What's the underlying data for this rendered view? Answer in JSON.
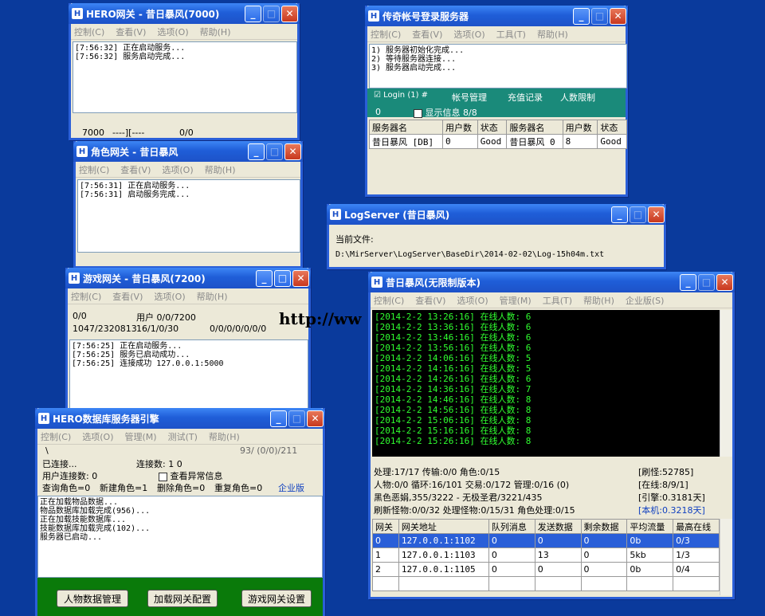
{
  "hero_gate": {
    "title": "HERO网关 - 昔日暴风(7000)",
    "menu": [
      "控制(C)",
      "查看(V)",
      "选项(O)",
      "帮助(H)"
    ],
    "log": [
      "[7:56:32] 正在启动服务...",
      "[7:56:32] 服务启动完成..."
    ],
    "status": [
      "7000",
      "----][----",
      "0/0"
    ]
  },
  "login_srv": {
    "title": "传奇帐号登录服务器",
    "menu": [
      "控制(C)",
      "查看(V)",
      "选项(O)",
      "工具(T)",
      "帮助(H)"
    ],
    "log": [
      "1) 服务器初始化完成...",
      "2) 等待服务器连接...",
      "3) 服务器启动完成..."
    ],
    "login_tab": "Login (1) #",
    "tabs": [
      "帐号管理",
      "充值记录",
      "人数限制"
    ],
    "count": "0",
    "show_info": "显示信息",
    "ratio": "8/8",
    "headers": [
      "服务器名",
      "用户数",
      "状态",
      "服务器名",
      "用户数",
      "状态"
    ],
    "row": [
      "昔日暴风 [DB]",
      "0",
      "Good",
      "昔日暴风 0",
      "8",
      "Good"
    ]
  },
  "role_gate": {
    "title": "角色网关 - 昔日暴风",
    "menu": [
      "控制(C)",
      "查看(V)",
      "选项(O)",
      "帮助(H)"
    ],
    "log": [
      "[7:56:31] 正在启动服务...",
      "[7:56:31] 启动服务完成..."
    ]
  },
  "log_server": {
    "title": "LogServer (昔日暴风)",
    "label": "当前文件:",
    "path": "D:\\MirServer\\LogServer\\BaseDir\\2014-02-02\\Log-15h04m.txt"
  },
  "game_gate": {
    "title": "游戏网关 - 昔日暴风(7200)",
    "menu": [
      "控制(C)",
      "查看(V)",
      "选项(O)",
      "帮助(H)"
    ],
    "l1": "0/0",
    "l2": "用户 0/0/7200",
    "l3": "1047/2320813",
    "l4": "16/1/0/30",
    "l5": "0/0/0/0/0/0/0",
    "log": [
      "[7:56:25] 正在启动服务...",
      "[7:56:25] 服务已启动成功...",
      "[7:56:25] 连接成功 127.0.0.1:5000"
    ]
  },
  "db_srv": {
    "title": "HERO数据库服务器引擎",
    "menu": [
      "控制(C)",
      "选项(O)",
      "管理(M)",
      "测试(T)",
      "帮助(H)"
    ],
    "slash": "\\",
    "topright": "93/ (0/0)/211",
    "connected": "已连接...",
    "conn_count": "连接数: 1    0",
    "user_conn": "用户连接数:    0",
    "check_label": "查看异常信息",
    "query": "查询角色=0",
    "new_role": "新建角色=1",
    "del_role": "删除角色=0",
    "dup_role": "重复角色=0",
    "edition": "企业版",
    "log": [
      "正在加载物品数据...",
      "物品数据库加载完成(956)...",
      "正在加载技能数据库...",
      "技能数据库加载完成(102)...",
      "服务器已启动..."
    ],
    "buttons": [
      "人物数据管理",
      "加载网关配置",
      "游戏网关设置"
    ]
  },
  "watermark": "http://ww",
  "main": {
    "title": "昔日暴风(无限制版本)",
    "menu": [
      "控制(C)",
      "查看(V)",
      "选项(O)",
      "管理(M)",
      "工具(T)",
      "帮助(H)",
      "企业版(S)"
    ],
    "log": [
      "[2014-2-2 13:26:16] 在线人数: 6",
      "[2014-2-2 13:36:16] 在线人数: 6",
      "[2014-2-2 13:46:16] 在线人数: 6",
      "[2014-2-2 13:56:16] 在线人数: 6",
      "[2014-2-2 14:06:16] 在线人数: 5",
      "[2014-2-2 14:16:16] 在线人数: 5",
      "[2014-2-2 14:26:16] 在线人数: 6",
      "[2014-2-2 14:36:16] 在线人数: 7",
      "[2014-2-2 14:46:16] 在线人数: 8",
      "[2014-2-2 14:56:16] 在线人数: 8",
      "[2014-2-2 15:06:16] 在线人数: 8",
      "[2014-2-2 15:16:16] 在线人数: 8",
      "[2014-2-2 15:26:16] 在线人数: 8"
    ],
    "s1": "处理:17/17 传输:0/0 角色:0/15",
    "s1r": "[刷怪:52785]",
    "s2": "人物:0/0 循环:16/101 交易:0/172 管理:0/16 (0)",
    "s2r": "[在线:8/9/1]",
    "s3": "黑色恶娟,355/3222 - 无极圣君/3221/435",
    "s3r": "[引擎:0.3181天]",
    "s4": "刷新怪物:0/0/32 处理怪物:0/15/31 角色处理:0/15",
    "s4r": "[本机:0.3218天]",
    "headers": [
      "网关",
      "网关地址",
      "队列消息",
      "发送数据",
      "剩余数据",
      "平均流量",
      "最高在线"
    ],
    "rows": [
      [
        "0",
        "127.0.0.1:1102",
        "0",
        "0",
        "0",
        "0b",
        "0/3"
      ],
      [
        "1",
        "127.0.0.1:1103",
        "0",
        "13",
        "0",
        "5kb",
        "1/3"
      ],
      [
        "2",
        "127.0.0.1:1105",
        "0",
        "0",
        "0",
        "0b",
        "0/4"
      ]
    ]
  }
}
